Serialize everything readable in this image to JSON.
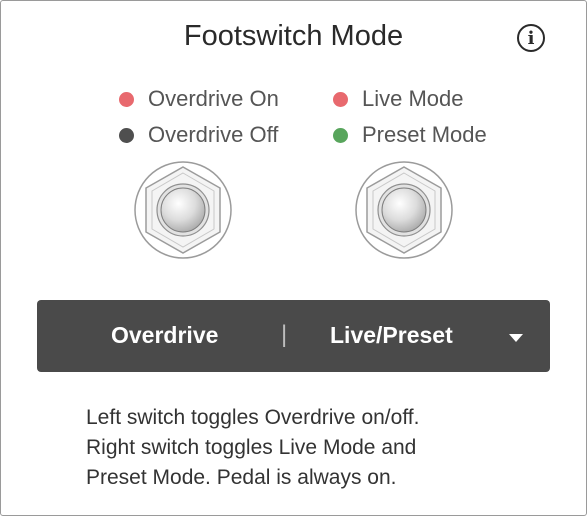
{
  "title": "Footswitch Mode",
  "info_icon": "info-circle-icon",
  "legend_left": [
    {
      "label": "Overdrive On",
      "color": "#e8696e"
    },
    {
      "label": "Overdrive Off",
      "color": "#4f4f4f"
    }
  ],
  "legend_right": [
    {
      "label": "Live Mode",
      "color": "#e8696e"
    },
    {
      "label": "Preset Mode",
      "color": "#58a55c"
    }
  ],
  "mode_selector": {
    "left_label": "Overdrive",
    "separator": "|",
    "right_label": "Live/Preset",
    "dropdown_icon": "caret-down-icon"
  },
  "description": {
    "line1": "Left switch toggles Overdrive on/off.",
    "line2": "Right switch toggles Live Mode and",
    "line3": "Preset Mode. Pedal is always on."
  }
}
